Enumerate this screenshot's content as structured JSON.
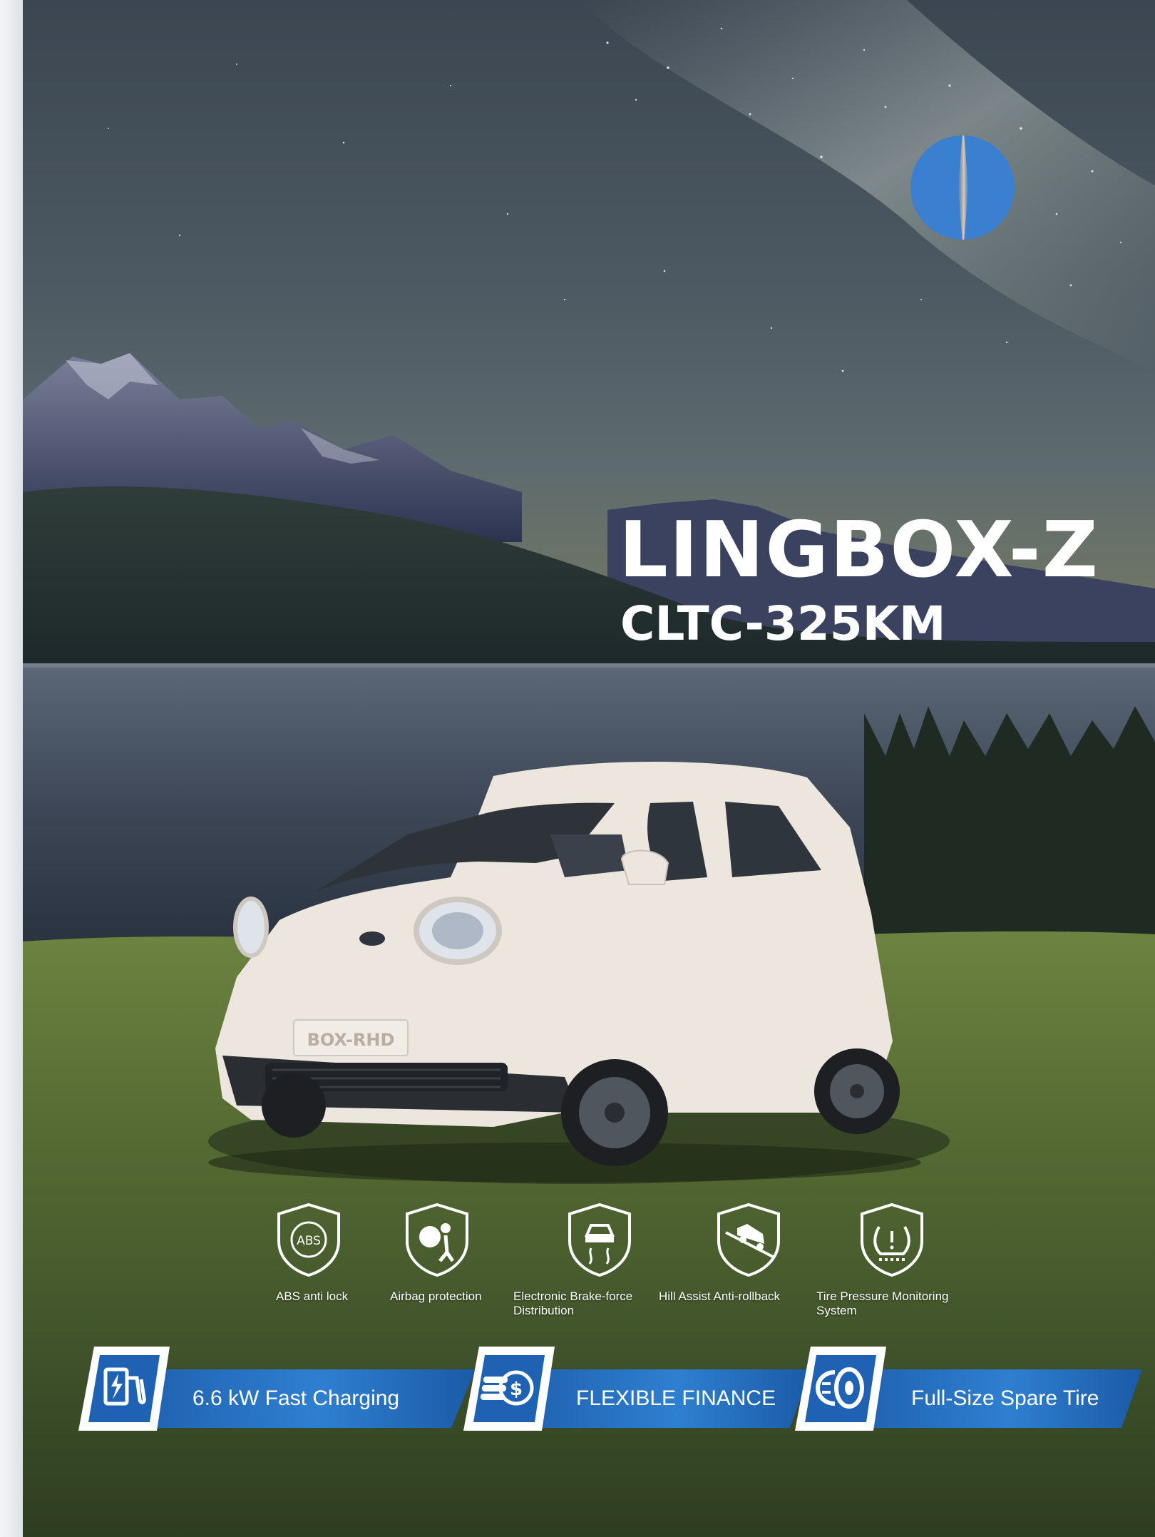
{
  "title": "LINGBOX-Z",
  "subtitle": "CLTC-325KM",
  "plate": "BOX-RHD",
  "features": [
    {
      "icon": "abs-shield-icon",
      "label": "ABS anti lock"
    },
    {
      "icon": "airbag-shield-icon",
      "label": "Airbag protection"
    },
    {
      "icon": "brake-shield-icon",
      "label": "Electronic Brake-force Distribution"
    },
    {
      "icon": "hill-assist-shield-icon",
      "label": "Hill Assist Anti-rollback"
    },
    {
      "icon": "tire-pressure-shield-icon",
      "label": "Tire Pressure Monitoring System"
    }
  ],
  "badges": [
    {
      "icon": "charging-icon",
      "label": "6.6 kW Fast Charging"
    },
    {
      "icon": "finance-coins-icon",
      "label": "FLEXIBLE FINANCE"
    },
    {
      "icon": "spare-tire-icon",
      "label": "Full-Size Spare Tire"
    }
  ],
  "colors": {
    "accent_blue": "#2f7fd0",
    "text": "#ffffff",
    "car_body": "#ece6df"
  }
}
